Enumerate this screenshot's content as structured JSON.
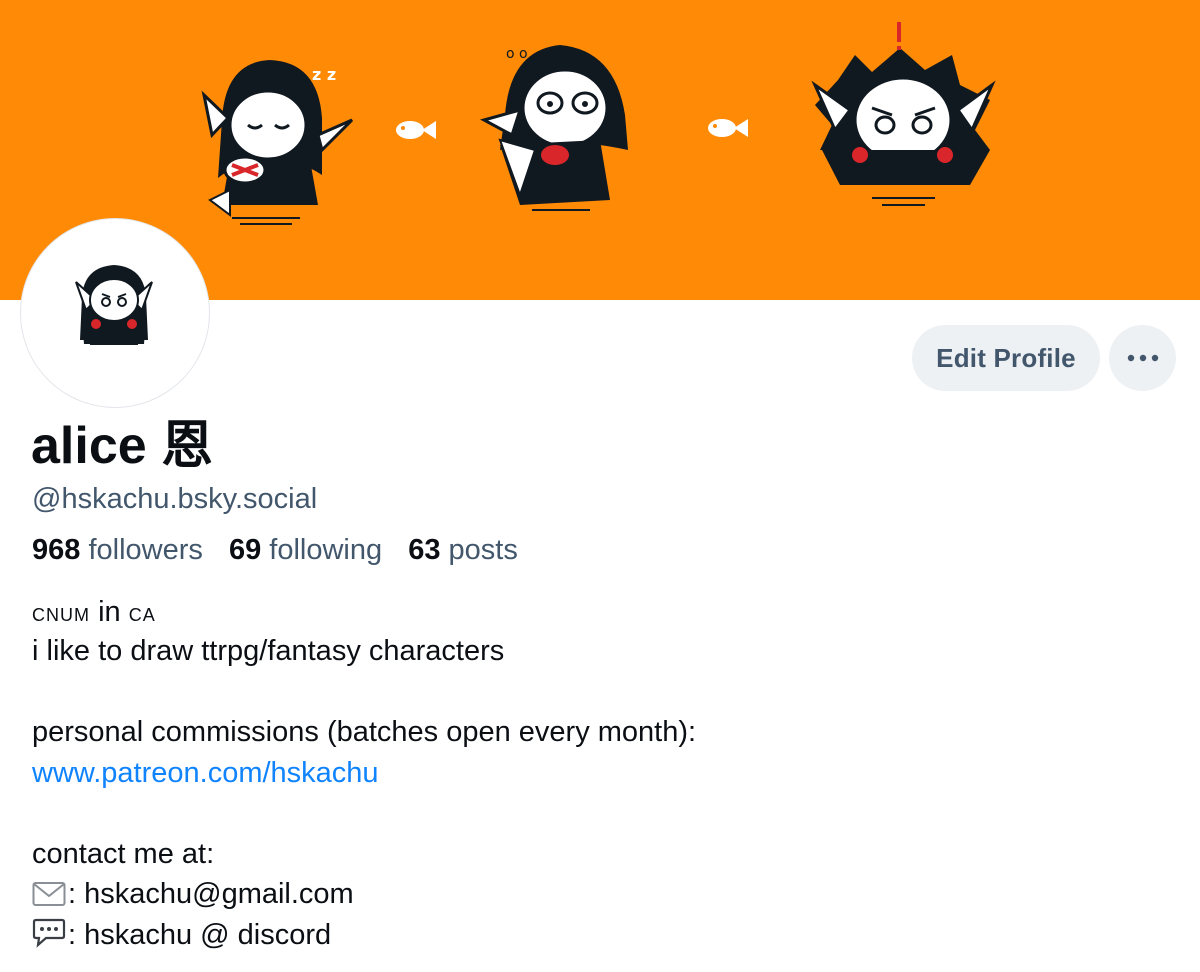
{
  "banner": {
    "background_color": "#ff8a05",
    "image": "three chibi vampire characters with fish between them"
  },
  "avatar": {
    "image": "chibi vampire character avatar"
  },
  "actions": {
    "edit_profile_label": "Edit Profile",
    "more_icon": "ellipsis-icon"
  },
  "profile": {
    "display_name": "alice 恩",
    "handle": "@hskachu.bsky.social"
  },
  "stats": {
    "followers_count": "968",
    "followers_label": "followers",
    "following_count": "69",
    "following_label": "following",
    "posts_count": "63",
    "posts_label": "posts"
  },
  "bio": {
    "line1_a": "cnum",
    "line1_b": "in",
    "line1_c": "ca",
    "line2": "i like to draw ttrpg/fantasy characters",
    "line3": "personal commissions (batches open every month):",
    "link": "www.patreon.com/hskachu",
    "line4": "contact me at:",
    "email_icon": "envelope-icon",
    "email": ": hskachu@gmail.com",
    "discord_icon": "speech-bubble-icon",
    "discord": ": hskachu @ discord"
  },
  "colors": {
    "text_primary": "#0b0f14",
    "text_secondary": "#42576c",
    "link": "#1083fe",
    "button_bg": "#eef1f4"
  }
}
